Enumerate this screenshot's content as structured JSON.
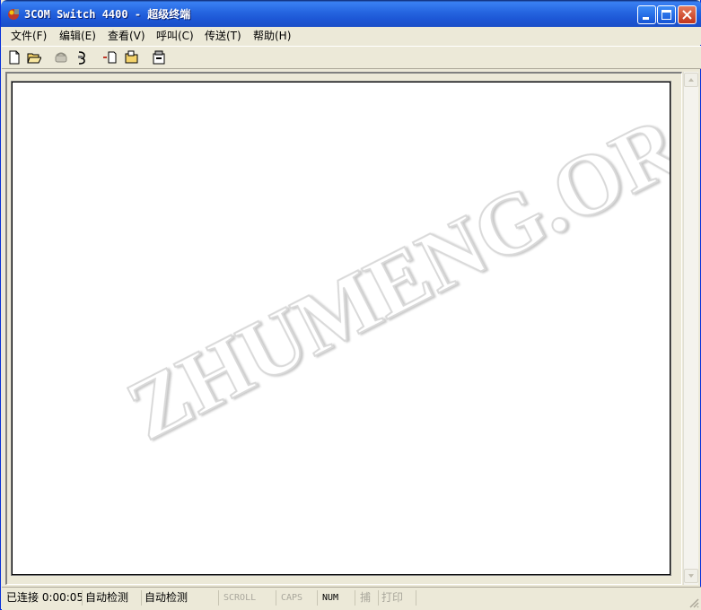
{
  "window": {
    "title": "3COM Switch 4400 - 超级终端",
    "controls": {
      "minimize": "minimize-icon",
      "maximize": "maximize-icon",
      "close": "close-icon"
    }
  },
  "menu": {
    "items": [
      {
        "label": "文件(F)"
      },
      {
        "label": "编辑(E)"
      },
      {
        "label": "查看(V)"
      },
      {
        "label": "呼叫(C)"
      },
      {
        "label": "传送(T)"
      },
      {
        "label": "帮助(H)"
      }
    ]
  },
  "toolbar": {
    "buttons": [
      {
        "icon": "new-connection-icon"
      },
      {
        "icon": "open-icon"
      },
      {
        "icon": "call-icon"
      },
      {
        "icon": "disconnect-icon"
      },
      {
        "icon": "send-icon"
      },
      {
        "icon": "receive-icon"
      },
      {
        "icon": "properties-icon"
      }
    ]
  },
  "terminal": {
    "watermark": "ZHUMENG.ORG"
  },
  "statusbar": {
    "connection": "已连接 0:00:05",
    "detect1": "自动检测",
    "detect2": "自动检测",
    "scroll": "SCROLL",
    "caps": "CAPS",
    "num": "NUM",
    "capture": "捕",
    "print": "打印"
  },
  "colors": {
    "titlebar": "#2565e0",
    "chrome": "#ece9d8",
    "terminal_bg": "#ffffff"
  }
}
